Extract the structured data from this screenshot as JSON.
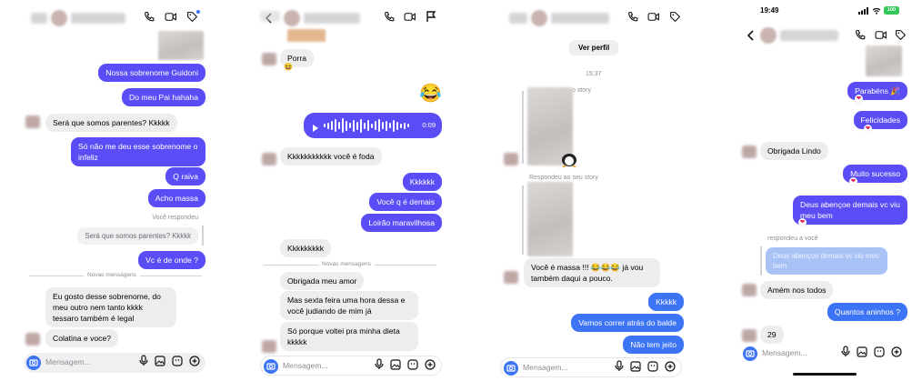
{
  "accent_colors": {
    "purple": "#5b4df5",
    "blue": "#3d74f5",
    "incoming": "#ededee",
    "heart": "#e0245e"
  },
  "panel1": {
    "messages": [
      "Nossa sobrenome Guidoni",
      "Do meu Pai hahaha",
      "Será que somos parentes? Kkkkk",
      "Só não me deu esse sobrenome o infeliz",
      "Q raiva",
      "Acho massa",
      "Vc é de onde ?",
      "Eu gosto desse sobrenome, do meu outro nem tanto kkkk tessaro também é legal",
      "Colatina e voce?"
    ],
    "replied_label": "Você respondeu",
    "reply_quote": "Será que somos parentes? Kkkkk",
    "new_messages_label": "Novas mensagens",
    "composer_placeholder": "Mensagem..."
  },
  "panel2": {
    "messages": [
      "Porra",
      "Kkkkkkkkkkk você é foda",
      "Kkkkkk",
      "Você q é demais",
      "Loirão maravilhosa",
      "Kkkkkkkkk",
      "Obrigada meu amor",
      "Mas sexta feira uma hora dessa e você judiando de mim já",
      "Só porque voltei pra minha dieta kkkkk"
    ],
    "voice_duration": "0:09",
    "new_messages_label": "Novas mensagens",
    "composer_placeholder": "Mensagem...",
    "emoji_reaction": "😂",
    "emoji_small": "😆"
  },
  "panel3": {
    "see_profile": "Ver perfil",
    "timestamp": "15:37",
    "story_label_1": "… o story",
    "story_label_2": "Respondeu ao seu story",
    "messages": [
      "Você é massa !!! 😂😂😂 já vou também daqui a pouco.",
      "Kkkkk",
      "Vamos correr atrás do balde",
      "Não tem jeito"
    ],
    "composer_placeholder": "Mensagem..."
  },
  "panel4": {
    "status_time": "19:49",
    "messages": [
      "Parabéns 🎉",
      "Felicidades",
      "Obrigada Lindo",
      "Muito sucesso",
      "Deus abençoe demais vc viu meu bem",
      "Amém nos todos",
      "Quantos aninhos ?",
      "29"
    ],
    "replied_label": "respondeu a você",
    "reply_quote": "Deus abençoe demais vc viu meu bem",
    "composer_placeholder": "Mensagem...",
    "battery": "100"
  }
}
